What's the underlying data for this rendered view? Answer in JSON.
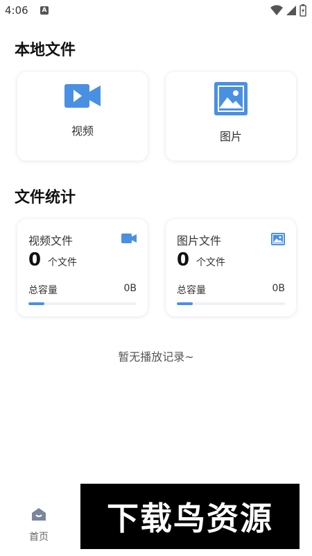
{
  "status_bar": {
    "time": "4:06",
    "notification_badge": "A"
  },
  "local_files": {
    "title": "本地文件",
    "tiles": [
      {
        "label": "视频",
        "icon": "video-camera-icon"
      },
      {
        "label": "图片",
        "icon": "image-icon"
      }
    ]
  },
  "file_stats": {
    "title": "文件统计",
    "cards": [
      {
        "name": "视频文件",
        "count": "0",
        "unit": "个文件",
        "capacity_label": "总容量",
        "capacity_value": "0B",
        "progress_fraction": 0.15,
        "icon": "video-camera-icon"
      },
      {
        "name": "图片文件",
        "count": "0",
        "unit": "个文件",
        "capacity_label": "总容量",
        "capacity_value": "0B",
        "progress_fraction": 0.15,
        "icon": "image-icon"
      }
    ]
  },
  "empty_state": "暂无播放记录~",
  "bottom_nav": {
    "home_label": "首页"
  },
  "watermark": "下载鸟资源",
  "colors": {
    "accent": "#4a90e2",
    "track": "#eef1f5"
  }
}
